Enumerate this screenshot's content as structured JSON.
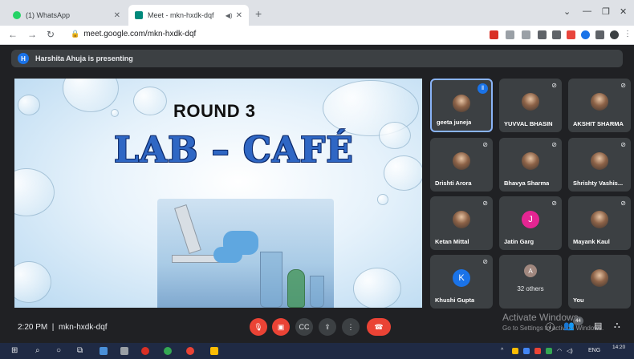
{
  "browser": {
    "tabs": [
      {
        "title": "(1) WhatsApp",
        "favicon": "whatsapp-icon",
        "color": "#25d366"
      },
      {
        "title": "Meet - mkn-hxdk-dqf",
        "favicon": "meet-icon",
        "color": "#00897b"
      }
    ],
    "url": "meet.google.com/mkn-hxdk-dqf"
  },
  "presenting": {
    "initial": "H",
    "text": "Harshita Ahuja is presenting"
  },
  "slide": {
    "round": "ROUND 3",
    "title": "LAB – CAFÉ"
  },
  "participants": [
    {
      "name": "geeta juneja",
      "type": "photo",
      "speaking": true
    },
    {
      "name": "YUVVAL BHASIN",
      "type": "photo",
      "muted": true
    },
    {
      "name": "AKSHIT SHARMA",
      "type": "photo",
      "muted": true
    },
    {
      "name": "Drishti Arora",
      "type": "photo",
      "muted": true
    },
    {
      "name": "Bhavya Sharma",
      "type": "photo",
      "muted": true
    },
    {
      "name": "Shrishty Vashis...",
      "type": "photo",
      "muted": true
    },
    {
      "name": "Ketan Mittal",
      "type": "photo",
      "muted": true
    },
    {
      "name": "Jatin Garg",
      "type": "letter",
      "initial": "J",
      "color": "#e52592",
      "muted": true
    },
    {
      "name": "Mayank Kaul",
      "type": "photo",
      "muted": true
    },
    {
      "name": "Khushi Gupta",
      "type": "letter",
      "initial": "K",
      "color": "#1a73e8",
      "muted": true
    },
    {
      "name": "",
      "type": "others",
      "initial": "A",
      "color": "#a1887f",
      "others_label": "32 others"
    },
    {
      "name": "You",
      "type": "photo"
    }
  ],
  "call": {
    "time": "2:20 PM",
    "code": "mkn-hxdk-dqf",
    "participant_count": "44"
  },
  "watermark": {
    "line1": "Activate Windows",
    "line2": "Go to Settings to activate Windows."
  },
  "taskbar": {
    "language": "ENG",
    "time": "14:20"
  }
}
